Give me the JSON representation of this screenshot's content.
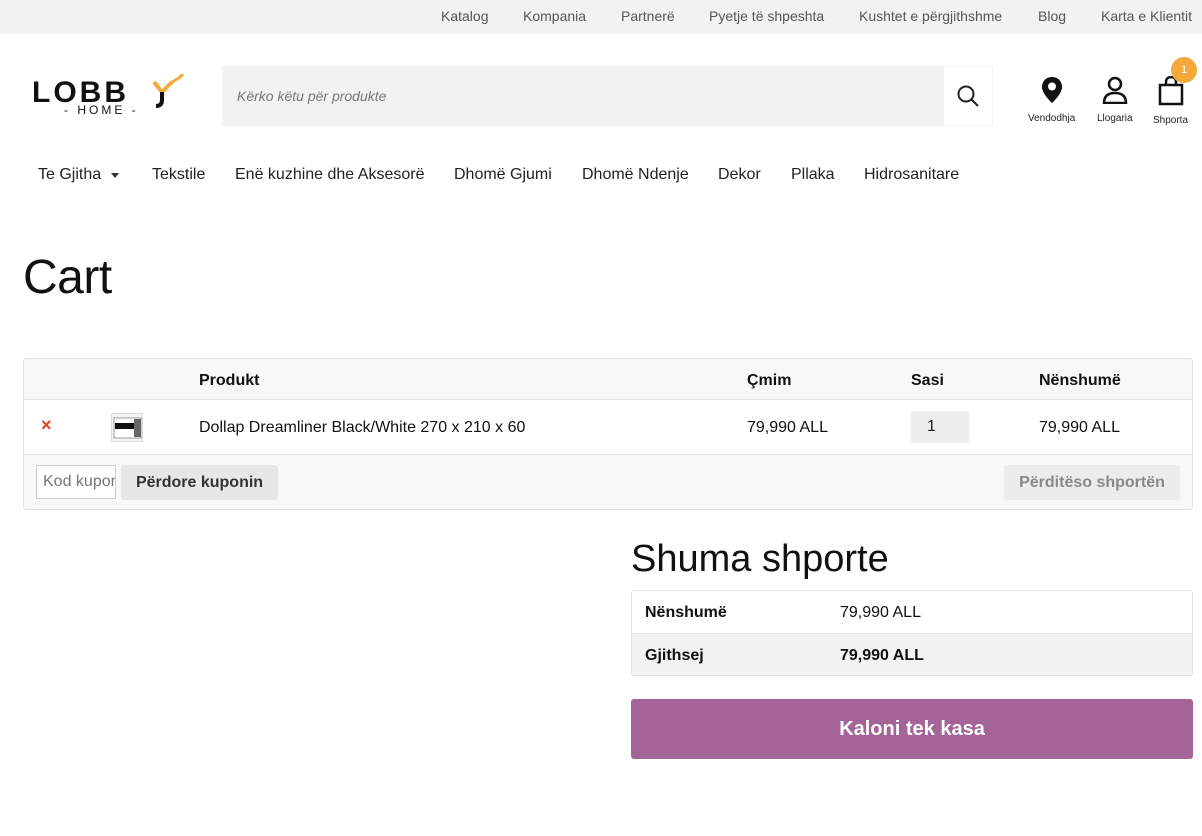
{
  "topbar": {
    "links": [
      "Katalog",
      "Kompania",
      "Partnerë",
      "Pyetje të shpeshta",
      "Kushtet e përgjithshme",
      "Blog",
      "Karta e Klientit"
    ]
  },
  "logo": {
    "word": "LOBBY",
    "sub": "- HOME -"
  },
  "search": {
    "placeholder": "Kërko këtu për produkte"
  },
  "header_icons": {
    "location": "Vendodhja",
    "account": "Llogaria",
    "cart": "Shporta",
    "cart_count": "1"
  },
  "nav": {
    "items": [
      "Te Gjitha",
      "Tekstile",
      "Enë kuzhine dhe Aksesorë",
      "Dhomë Gjumi",
      "Dhomë Ndenje",
      "Dekor",
      "Pllaka",
      "Hidrosanitare"
    ]
  },
  "page_title": "Cart",
  "cart": {
    "headers": {
      "product": "Produkt",
      "price": "Çmim",
      "qty": "Sasi",
      "subtotal": "Nënshumë"
    },
    "items": [
      {
        "name": "Dollap Dreamliner Black/White 270 x 210 x 60",
        "price": "79,990 ALL",
        "qty": "1",
        "subtotal": "79,990 ALL"
      }
    ],
    "coupon_placeholder": "Kod kuponi",
    "apply_coupon": "Përdore kuponin",
    "update_cart": "Përditëso shportën"
  },
  "totals": {
    "title": "Shuma shporte",
    "subtotal_label": "Nënshumë",
    "subtotal_value": "79,990 ALL",
    "total_label": "Gjithsej",
    "total_value": "79,990 ALL",
    "checkout": "Kaloni tek kasa"
  },
  "colors": {
    "accent": "#a46497",
    "badge": "#f4a93b",
    "remove": "#e2401c"
  }
}
